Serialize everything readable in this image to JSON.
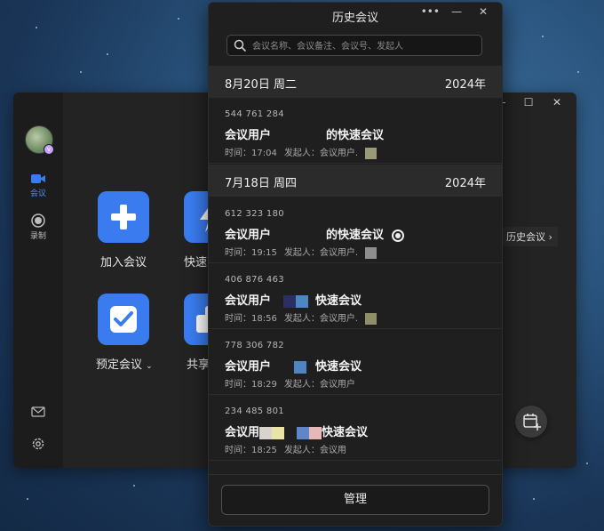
{
  "main": {
    "sidebar": {
      "meeting_label": "会议",
      "record_label": "录制"
    },
    "actions": {
      "join": "加入会议",
      "quick": "快速会",
      "schedule": "预定会议",
      "share": "共享"
    },
    "history_link": "历史会议"
  },
  "panel": {
    "title": "历史会议",
    "search_placeholder": "会议名称、会议备注、会议号、发起人",
    "manage_label": "管理",
    "groups": [
      {
        "date": "8月20日 周二",
        "year": "2024年",
        "items": [
          {
            "id": "544 761 284",
            "title_prefix": "会议用户",
            "title_suffix": "的快速会议",
            "time": "时间：17:04",
            "initiator": "发起人：会议用户."
          }
        ]
      },
      {
        "date": "7月18日 周四",
        "year": "2024年",
        "items": [
          {
            "id": "612 323 180",
            "title_prefix": "会议用户",
            "title_suffix": "的快速会议",
            "time": "时间：19:15",
            "initiator": "发起人：会议用户."
          },
          {
            "id": "406 876 463",
            "title_prefix": "会议用户",
            "title_suffix": "快速会议",
            "time": "时间：18:56",
            "initiator": "发起人：会议用户."
          },
          {
            "id": "778 306 782",
            "title_prefix": "会议用户",
            "title_suffix": "快速会议",
            "time": "时间：18:29",
            "initiator": "发起人：会议用户"
          },
          {
            "id": "234 485 801",
            "title_prefix": "会议用",
            "title_suffix": "快速会议",
            "time": "时间：18:25",
            "initiator": "发起人：会议用"
          }
        ]
      }
    ]
  },
  "colors": {
    "accent": "#3a7cf0",
    "panel_bg": "#1f1f20",
    "date_row_bg": "#2b2b2c"
  }
}
